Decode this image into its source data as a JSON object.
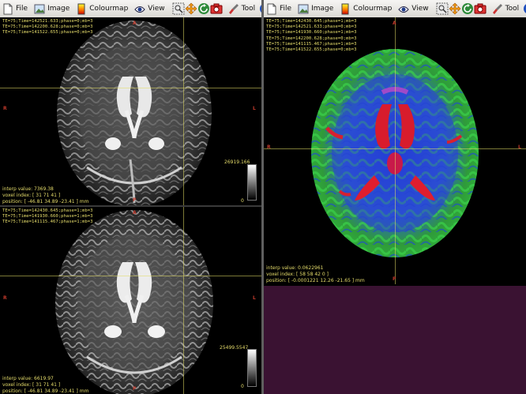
{
  "toolbar": {
    "file": "File",
    "image": "Image",
    "colourmap": "Colourmap",
    "view": "View",
    "tool": "Tool"
  },
  "left": {
    "top_view": {
      "header": "TE=75;Time=142521.633;phase=0;mb=3\nTE=75;Time=142200.628;phase=0;mb=3\nTE=75;Time=141522.655;phase=0;mb=3",
      "orient": {
        "top": "A",
        "bottom": "P",
        "left": "R",
        "right": "L"
      },
      "readout": "interp value: 7369.38\nvoxel index: [ 31 71 41 ]\nposition: [ -46.81 34.89 -23.41 ] mm",
      "cbar_max": "26919.166",
      "cbar_min": "0"
    },
    "bottom_view": {
      "header": "TE=75;Time=142430.645;phase=1;mb=3\nTE=75;Time=141930.660;phase=1;mb=3\nTE=75;Time=141115.467;phase=1;mb=3",
      "orient": {
        "top": "A",
        "bottom": "P",
        "left": "R",
        "right": "L"
      },
      "readout": "interp value: 6619.97\nvoxel index: [ 31 71 41 ]\nposition: [ -46.81 34.89 -23.41 ] mm",
      "cbar_max": "25499.5547",
      "cbar_min": "0"
    }
  },
  "right": {
    "main_view": {
      "header": "TE=75;Time=142430.645;phase=1;mb=3\nTE=75;Time=142521.633;phase=0;mb=3\nTE=75;Time=141930.660;phase=1;mb=3\nTE=75;Time=142200.628;phase=0;mb=3\nTE=75;Time=141115.467;phase=1;mb=3\nTE=75;Time=141522.655;phase=0;mb=3",
      "orient": {
        "top": "A",
        "bottom": "P",
        "left": "R",
        "right": "L"
      },
      "readout": "interp value: 0.0622961\nvoxel index: [ 58 58 42 0 ]\nposition: [ -0.0001221 12.26 -21.65 ] mm"
    }
  },
  "colors": {
    "annotation": "#e6dd6b",
    "orientation": "#c0392b",
    "empty_panel": "#3a1232"
  }
}
